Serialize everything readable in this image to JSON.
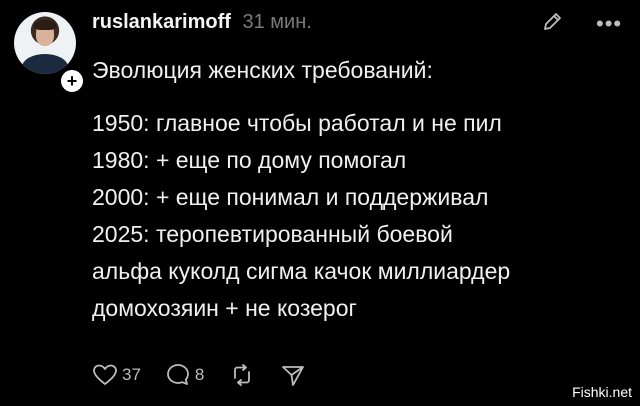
{
  "post": {
    "username": "ruslankarimoff",
    "timestamp": "31 мин.",
    "title": "Эволюция женских требований:",
    "lines": [
      "1950: главное чтобы работал и не пил",
      "1980: + еще по дому помогал",
      "2000: + еще понимал и поддерживал",
      "2025: теропевтированный боевой",
      "альфа куколд сигма качок миллиардер",
      "домохозяин + не козерог"
    ],
    "likes": "37",
    "comments": "8"
  },
  "icons": {
    "avatar_badge": "plus-icon",
    "edit": "pencil-icon",
    "more": "more-icon",
    "like": "heart-icon",
    "comment": "comment-icon",
    "repost": "repost-icon",
    "share": "send-icon"
  },
  "watermark": "Fishki.net",
  "colors": {
    "background": "#000000",
    "text": "#f0f0f0",
    "muted": "#7a7a7a"
  }
}
